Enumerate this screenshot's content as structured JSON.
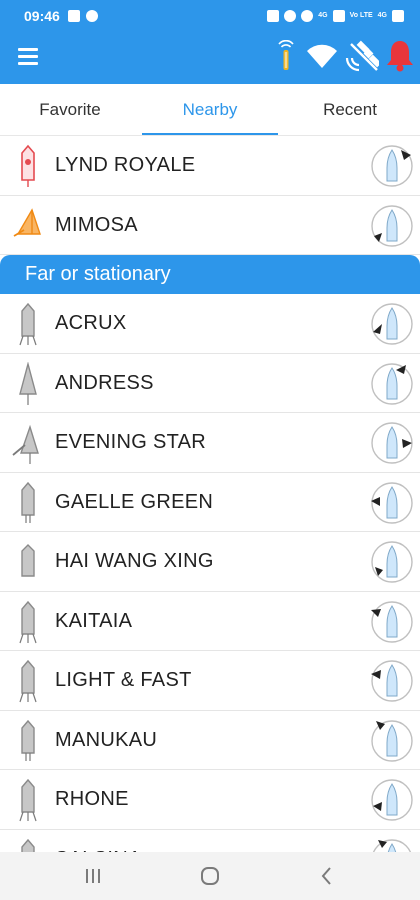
{
  "status_bar": {
    "time": "09:46",
    "network_label_1": "4G",
    "network_label_2": "4G",
    "volte_label": "Vo LTE"
  },
  "app_bar": {
    "icons": [
      "menu-icon",
      "location-pin-icon",
      "wifi-icon",
      "satellite-off-icon",
      "alarm-bell-icon"
    ],
    "colors": {
      "primary": "#2d96ea",
      "alarm": "#e8363c",
      "pin": "#f2b51f"
    }
  },
  "tabs": [
    {
      "label": "Favorite",
      "active": false
    },
    {
      "label": "Nearby",
      "active": true
    },
    {
      "label": "Recent",
      "active": false
    }
  ],
  "nearby_vessels": [
    {
      "name": "LYND ROYALE",
      "icon": "red-vessel-icon"
    },
    {
      "name": "MIMOSA",
      "icon": "orange-sailing-vessel-icon"
    }
  ],
  "section_header": "Far or stationary",
  "far_vessels": [
    {
      "name": "ACRUX"
    },
    {
      "name": "ANDRESS"
    },
    {
      "name": "EVENING STAR"
    },
    {
      "name": "GAELLE GREEN"
    },
    {
      "name": "HAI WANG XING"
    },
    {
      "name": "KAITAIA"
    },
    {
      "name": "LIGHT & FAST"
    },
    {
      "name": "MANUKAU"
    },
    {
      "name": "RHONE"
    },
    {
      "name": "SALSINA"
    }
  ],
  "nav_bar": {
    "icons": [
      "recent-apps-icon",
      "home-icon",
      "back-icon"
    ]
  }
}
